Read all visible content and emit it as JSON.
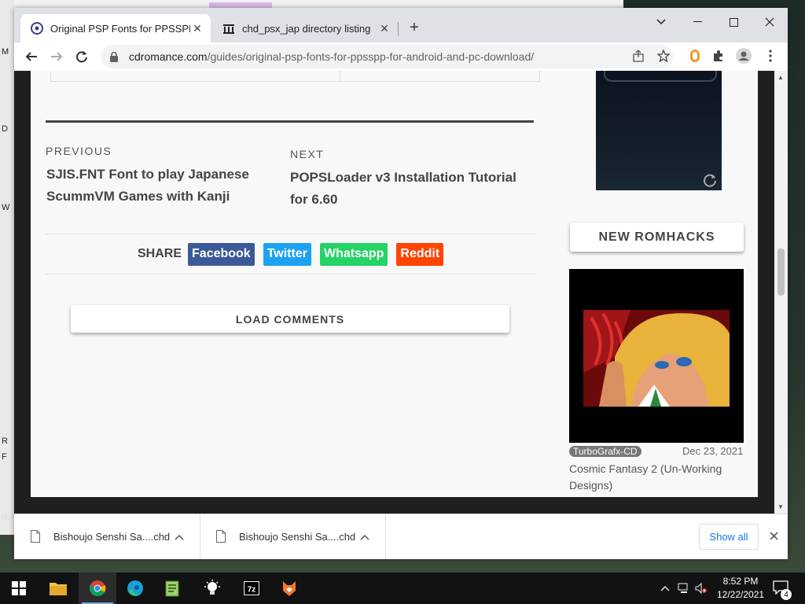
{
  "browser": {
    "tabs": [
      {
        "title": "Original PSP Fonts for PPSSPP fo",
        "active": true,
        "icon": "cdromance-favicon"
      },
      {
        "title": "chd_psx_jap directory listing",
        "active": false,
        "icon": "archive-favicon"
      }
    ],
    "new_tab_label": "+",
    "window_controls": {
      "dropdown": "⌄",
      "minimize": "—",
      "maximize": "☐",
      "close": "✕"
    },
    "url_host": "cdromance.com",
    "url_path": "/guides/original-psp-fonts-for-ppsspp-for-android-and-pc-download/"
  },
  "page": {
    "previous": {
      "label": "PREVIOUS",
      "title": "SJIS.FNT Font to play Japanese ScummVM Games with Kanji"
    },
    "next": {
      "label": "NEXT",
      "title": "POPSLoader v3 Installation Tutorial for 6.60"
    },
    "share": {
      "label": "SHARE",
      "buttons": [
        {
          "label": "Facebook",
          "color": "#3b5998"
        },
        {
          "label": "Twitter",
          "color": "#1da1f2"
        },
        {
          "label": "Whatsapp",
          "color": "#25d366"
        },
        {
          "label": "Reddit",
          "color": "#ff4500"
        }
      ]
    },
    "load_comments": "LOAD COMMENTS",
    "sidebar": {
      "section_title": "NEW ROMHACKS",
      "romhack": {
        "tag": "TurboGrafx-CD",
        "date": "Dec 23, 2021",
        "title": "Cosmic Fantasy 2 (Un-Working Designs)"
      }
    }
  },
  "downloads": {
    "items": [
      {
        "name": "Bishoujo Senshi Sa....chd"
      },
      {
        "name": "Bishoujo Senshi Sa....chd"
      }
    ],
    "show_all": "Show all"
  },
  "taskbar": {
    "clock_time": "8:52 PM",
    "clock_date": "12/22/2021",
    "notification_count": "4"
  },
  "desktop": {
    "left_labels": [
      "M",
      "D",
      "W",
      "R",
      "F",
      "Ro"
    ]
  }
}
